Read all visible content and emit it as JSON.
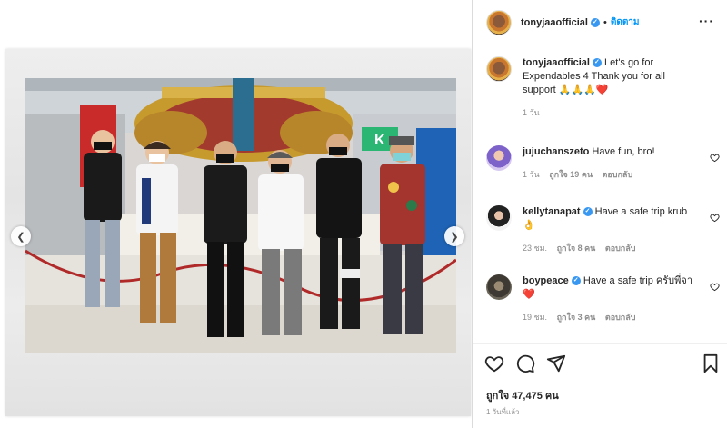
{
  "post": {
    "username": "tonyjaaofficial",
    "follow_label": "ติดตาม",
    "dot": "•",
    "more_label": "···",
    "caption": "Let's go for Expendables 4 Thank you for all support 🙏🙏🙏❤️",
    "caption_time": "1 วัน",
    "likes": "ถูกใจ 47,475 คน",
    "posted_time": "1 วันที่แล้ว"
  },
  "comments": [
    {
      "username": "jujuchanszeto",
      "text": "Have fun, bro!",
      "verified": false,
      "time": "1 วัน",
      "likes": "ถูกใจ 19 คน",
      "reply": "ตอบกลับ"
    },
    {
      "username": "kellytanapat",
      "text": "Have a safe trip krub 👌",
      "verified": true,
      "time": "23 ชม.",
      "likes": "ถูกใจ 8 คน",
      "reply": "ตอบกลับ"
    },
    {
      "username": "boypeace",
      "text": "Have a safe trip ครับพี่จา ❤️",
      "verified": true,
      "time": "19 ชม.",
      "likes": "ถูกใจ 3 คน",
      "reply": "ตอบกลับ"
    }
  ],
  "icons": {
    "prev": "chevron-left-icon",
    "next": "chevron-right-icon",
    "like": "heart-icon",
    "comment": "comment-icon",
    "share": "send-icon",
    "save": "bookmark-icon"
  },
  "colors": {
    "link_blue": "#0095f6",
    "verified_blue": "#3897f0",
    "muted": "#8e8e8e",
    "text": "#262626"
  }
}
